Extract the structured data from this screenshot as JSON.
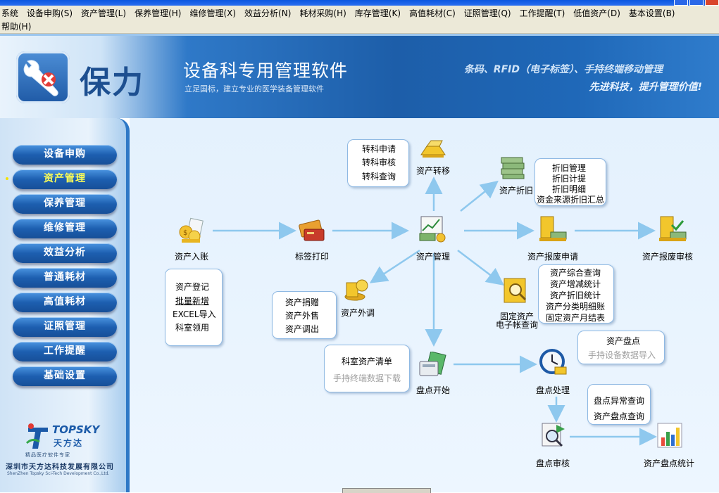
{
  "window": {
    "title": ""
  },
  "menu": {
    "items": [
      {
        "label": "系统"
      },
      {
        "label": "设备申购(S)"
      },
      {
        "label": "资产管理(L)"
      },
      {
        "label": "保养管理(H)"
      },
      {
        "label": "维修管理(X)"
      },
      {
        "label": "效益分析(N)"
      },
      {
        "label": "耗材采购(H)"
      },
      {
        "label": "库存管理(K)"
      },
      {
        "label": "高值耗材(C)"
      },
      {
        "label": "证照管理(Q)"
      },
      {
        "label": "工作提醒(T)"
      },
      {
        "label": "低值资产(D)"
      },
      {
        "label": "基本设置(B)"
      },
      {
        "label": "帮助(H)"
      }
    ]
  },
  "banner": {
    "logo_text": "保力",
    "title": "设备科专用管理软件",
    "subtitle": "立足国标，建立专业的医学装备管理软件",
    "slogan1": "条码、RFID（电子标签）、手持终端移动管理",
    "slogan2": "先进科技，提升管理价值!"
  },
  "sidebar": {
    "active_index": 1,
    "items": [
      {
        "label": "设备申购"
      },
      {
        "label": "资产管理"
      },
      {
        "label": "保养管理"
      },
      {
        "label": "维修管理"
      },
      {
        "label": "效益分析"
      },
      {
        "label": "普通耗材"
      },
      {
        "label": "高值耗材"
      },
      {
        "label": "证照管理"
      },
      {
        "label": "工作提醒"
      },
      {
        "label": "基础设置"
      }
    ],
    "company": {
      "brand": "TOPSKY",
      "brand_cn": "天方达",
      "tagline": "精品医疗软件专家",
      "name": "深圳市天方达科技发展有限公司",
      "name_en": "ShenZhen Topsky Sci-Tech Development Co.,Ltd."
    }
  },
  "flow": {
    "nodes": {
      "asset_entry": {
        "label": "资产入账",
        "icon": "coins-papers-icon"
      },
      "label_print": {
        "label": "标签打印",
        "icon": "card-printer-icon"
      },
      "asset_mgmt": {
        "label": "资产管理",
        "icon": "chart-money-icon"
      },
      "asset_transfer": {
        "label": "资产转移",
        "icon": "gold-bars-icon"
      },
      "depreciation": {
        "label": "资产折旧",
        "icon": "money-stack-icon"
      },
      "scrap_apply": {
        "label": "资产报废申请",
        "icon": "gold-stack-icon"
      },
      "scrap_review": {
        "label": "资产报废审核",
        "icon": "gold-stack-check-icon"
      },
      "asset_out": {
        "label": "资产外调",
        "icon": "coin-stack-icon"
      },
      "fixed_query": {
        "label": "固定资产\n电子帐查询",
        "icon": "safe-search-icon"
      },
      "inventory_start": {
        "label": "盘点开始",
        "icon": "calculator-icon"
      },
      "inventory_process": {
        "label": "盘点处理",
        "icon": "clock-coins-icon"
      },
      "inventory_review": {
        "label": "盘点审核",
        "icon": "document-search-icon"
      },
      "inventory_stats": {
        "label": "资产盘点统计",
        "icon": "bar-chart-icon"
      }
    },
    "bubbles": {
      "entry": {
        "items": [
          "资产登记",
          "批量新增",
          "EXCEL导入",
          "科室领用"
        ]
      },
      "transfer": {
        "items": [
          "转科申请",
          "转科审核",
          "转科查询"
        ]
      },
      "depreciation": {
        "items": [
          "折旧管理",
          "折旧计提",
          "折旧明细",
          "资金来源折旧汇总"
        ]
      },
      "out": {
        "items": [
          "资产捐赠",
          "资产外售",
          "资产调出"
        ]
      },
      "query": {
        "items": [
          "资产综合查询",
          "资产增减统计",
          "资产折旧统计",
          "资产分类明细账",
          "固定资产月结表"
        ]
      },
      "inventory_list": {
        "items": [
          "科室资产清单",
          "手持终端数据下载"
        ]
      },
      "inventory_check": {
        "items": [
          "资产盘点",
          "手持设备数据导入"
        ]
      },
      "inventory_query": {
        "items": [
          "盘点异常查询",
          "资产盘点查询"
        ]
      }
    }
  }
}
